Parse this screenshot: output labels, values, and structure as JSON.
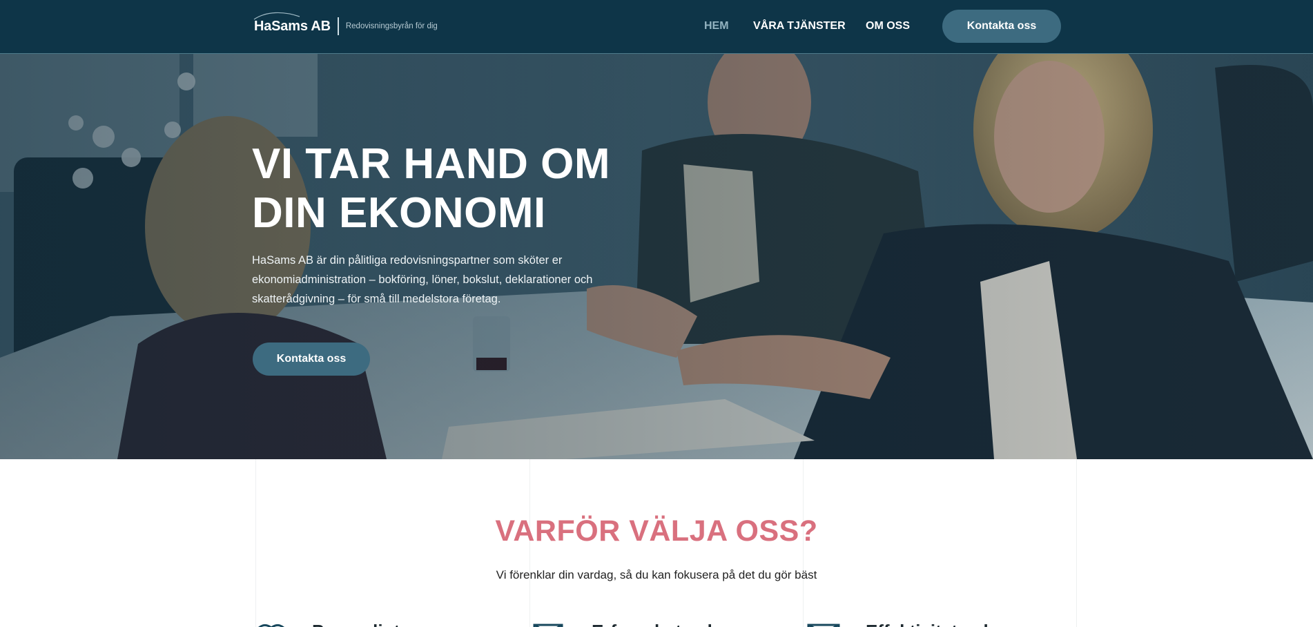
{
  "header": {
    "logo_name": "HaSams AB",
    "logo_tagline": "Redovisningsbyrån för dig",
    "nav": [
      {
        "label": "HEM",
        "active": true
      },
      {
        "label": "VÅRA TJÄNSTER",
        "active": false
      },
      {
        "label": "OM OSS",
        "active": false
      }
    ],
    "cta_label": "Kontakta oss",
    "colors": {
      "background": "#0e3548",
      "button": "#3d6b80",
      "active_nav": "#93b3c0"
    }
  },
  "hero": {
    "title_line1": "VI TAR HAND OM",
    "title_line2": "DIN EKONOMI",
    "text": "HaSams AB är din pålitliga redovisningspartner som sköter er ekonomiadministration – bokföring, löner, bokslut, deklarationer och skatterådgivning – för små till medelstora företag.",
    "cta_label": "Kontakta oss"
  },
  "why": {
    "title": "VARFÖR VÄLJA OSS?",
    "subtitle": "Vi förenklar din vardag, så du kan fokusera på det du gör bäst",
    "title_color": "#d9707e",
    "features": [
      {
        "icon": "handshake-icon",
        "title": "Personligt"
      },
      {
        "icon": "envelope-icon",
        "title": "Erfarenhet och"
      },
      {
        "icon": "envelope-icon",
        "title": "Effektivitet och"
      }
    ]
  }
}
